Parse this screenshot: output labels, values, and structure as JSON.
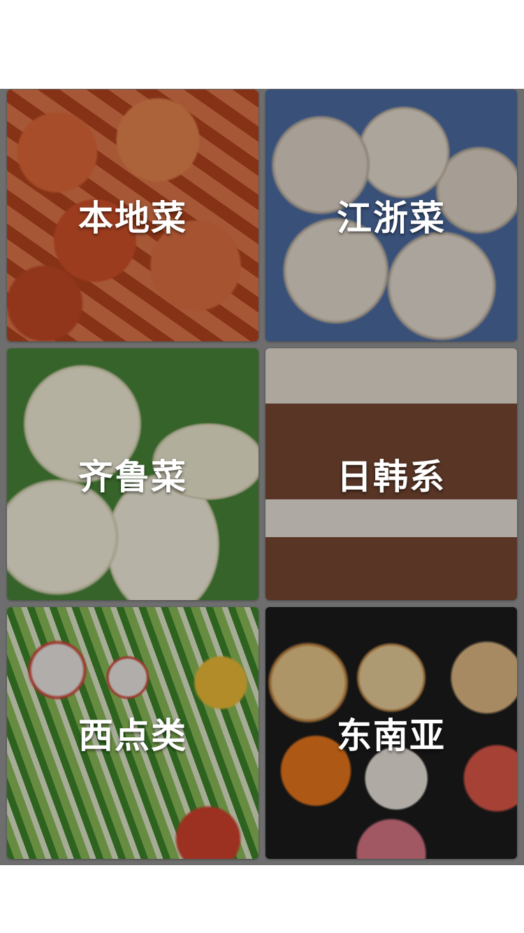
{
  "categories": [
    {
      "label": "本地菜",
      "icon": "shrimp-image"
    },
    {
      "label": "江浙菜",
      "icon": "steamed-bun-image"
    },
    {
      "label": "齐鲁菜",
      "icon": "mantou-image"
    },
    {
      "label": "日韩系",
      "icon": "cake-image"
    },
    {
      "label": "西点类",
      "icon": "asparagus-image"
    },
    {
      "label": "东南亚",
      "icon": "pastry-image"
    }
  ]
}
